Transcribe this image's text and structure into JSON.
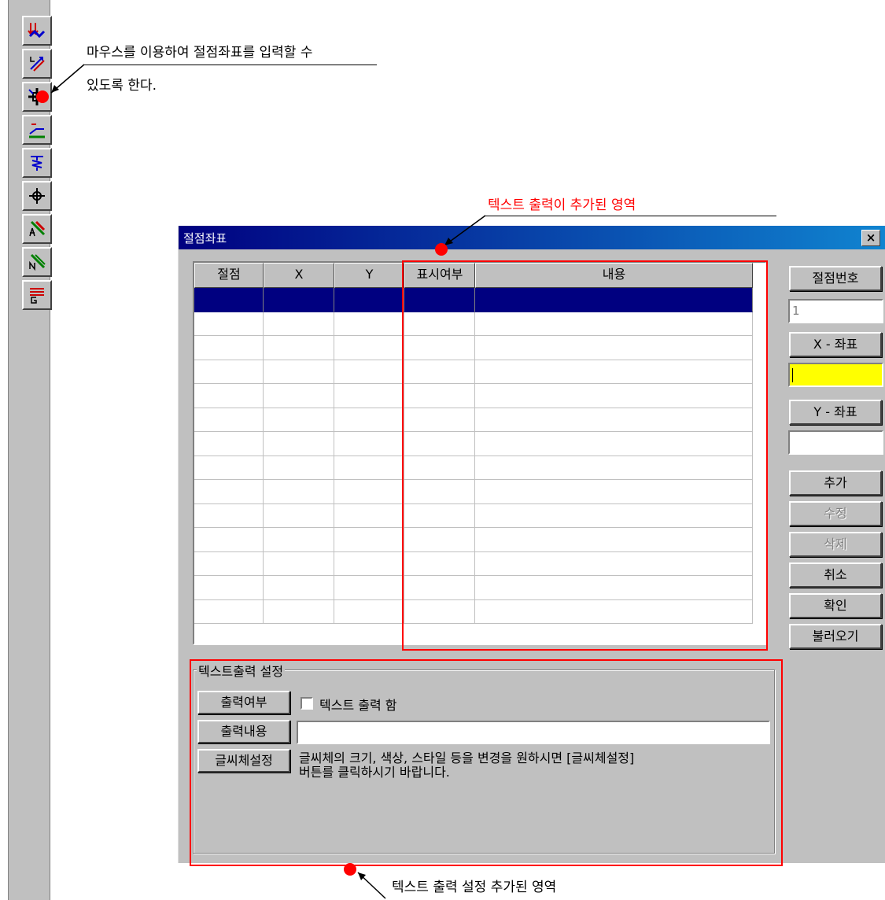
{
  "toolbar": {
    "icons": [
      "node-arrows-icon",
      "diagonal-arrows-icon",
      "node-crosshair-icon",
      "slope-icon",
      "spring-icon",
      "crosshair-icon",
      "pen-a-icon",
      "pen-n-icon",
      "lines-g-icon"
    ]
  },
  "annotations": {
    "top_line1": "마우스를 이용하여 절점좌표를 입력할 수",
    "top_line2": "있도록 한다.",
    "middle": "텍스트 출력이 추가된 영역",
    "bottom": "텍스트 출력 설정 추가된 영역"
  },
  "dialog": {
    "title": "절점좌표",
    "close_glyph": "×",
    "grid": {
      "columns": [
        "절점",
        "X",
        "Y",
        "표시여부",
        "내용"
      ],
      "row_count": 14,
      "selected_row": 0
    },
    "side": {
      "node_number_button": "절점번호",
      "node_number_value": "1",
      "x_button": "X - 좌표",
      "x_value": "",
      "y_button": "Y - 좌표",
      "y_value": "",
      "add": "추가",
      "modify": "수정",
      "delete": "삭제",
      "cancel": "취소",
      "ok": "확인",
      "load": "불러오기"
    },
    "text_output": {
      "group_title": "텍스트출력 설정",
      "output_flag_button": "출력여부",
      "checkbox_label": "텍스트 출력 함",
      "output_content_button": "출력내용",
      "output_content_value": "",
      "font_button": "글씨체설정",
      "font_help_line1": "글씨체의 크기, 색상, 스타일 등을 변경을 원하시면 [글씨체설정]",
      "font_help_line2": "버튼를 클릭하시기 바랍니다."
    }
  },
  "colors": {
    "title_gradient_start": "#000080",
    "title_gradient_end": "#1084d0",
    "highlight_box": "#ff0000",
    "edit_active": "#ffff00",
    "selection": "#000080"
  }
}
